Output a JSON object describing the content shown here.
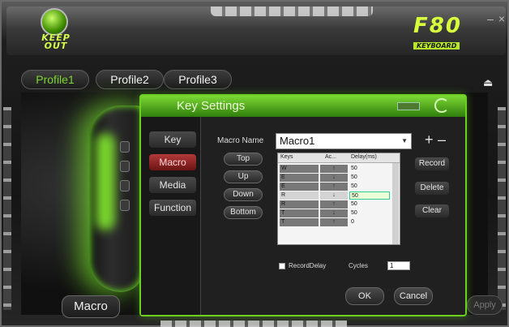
{
  "app": {
    "logo_text": "KEEP\nOUT",
    "brand_model": "F80",
    "brand_sub": "KEYBOARD"
  },
  "window": {
    "minimize_symbol": "–",
    "close_symbol": "×"
  },
  "profiles": {
    "items": [
      "Profile1",
      "Profile2",
      "Profile3"
    ],
    "active": "Profile1",
    "eject_symbol": "⏏"
  },
  "main": {
    "mode_label": "Macro",
    "apply_label": "Apply"
  },
  "dialog": {
    "title": "Key Settings",
    "sidebar": [
      "Key",
      "Macro",
      "Media",
      "Function"
    ],
    "sidebar_active": "Macro",
    "macro_name_label": "Macro Name",
    "macro_name_value": "Macro1",
    "dropdown_caret": "▼",
    "plus": "+",
    "minus": "–",
    "nav_buttons": [
      "Top",
      "Up",
      "Down",
      "Bottom"
    ],
    "table": {
      "headers": [
        "Keys",
        "Ac...",
        "Delay(ms)"
      ],
      "rows": [
        {
          "key": "W",
          "action": "↑",
          "delay": "50"
        },
        {
          "key": "E",
          "action": "↓",
          "delay": "50"
        },
        {
          "key": "E",
          "action": "↑",
          "delay": "50"
        },
        {
          "key": "R",
          "action": "↓",
          "delay": "50"
        },
        {
          "key": "R",
          "action": "↑",
          "delay": "50"
        },
        {
          "key": "T",
          "action": "↓",
          "delay": "50"
        },
        {
          "key": "T",
          "action": "↑",
          "delay": "0"
        }
      ],
      "selected_row": 3
    },
    "actions": [
      "Record",
      "Delete",
      "Clear"
    ],
    "record_delay_label": "RecordDelay",
    "cycles_label": "Cycles",
    "cycles_value": "1",
    "ok_label": "OK",
    "cancel_label": "Cancel"
  },
  "colors": {
    "accent": "#6bd120",
    "active_side": "#b23a3a"
  }
}
